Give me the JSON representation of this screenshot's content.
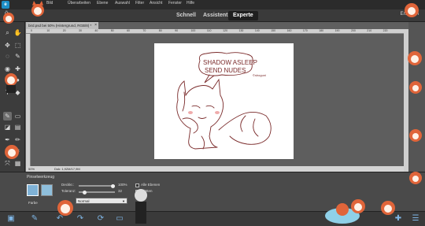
{
  "menubar": {
    "items": [
      "Bild",
      "Überarbeiten",
      "Ebene",
      "Auswahl",
      "Filter",
      "Ansicht",
      "Fenster",
      "Hilfe"
    ]
  },
  "modebar": {
    "open_label": "Ö",
    "modes": [
      "Schnell",
      "Assistent",
      "Experte"
    ],
    "active_mode": "Experte",
    "create_label": "Erstellen"
  },
  "document": {
    "tab_title": "bird.psd bei 50% (Hintergrund, RGB/8) *",
    "close_glyph": "×",
    "ruler_ticks": [
      "0",
      "10",
      "20",
      "30",
      "40",
      "50",
      "60",
      "70",
      "80",
      "90",
      "100",
      "110",
      "120",
      "130",
      "140",
      "150",
      "160",
      "170",
      "180",
      "190",
      "200",
      "210",
      "220"
    ]
  },
  "canvas": {
    "speech_line1": "SHADOW ASLEEP",
    "speech_line2": "SEND NUDES",
    "signature": "©shoguni"
  },
  "status": {
    "zoom": "50%",
    "doc_info": "Dok: 1,92M/17,9M"
  },
  "options": {
    "tool_name": "Pinselwerkzeug",
    "opacity_label": "Deckkr.:",
    "opacity_value": "100%",
    "opacity_level": 1.0,
    "tolerance_label": "Toleranz:",
    "tolerance_value": "32",
    "tolerance_level": 0.12,
    "blend_mode": "Normal",
    "all_layers_label": "Alle Ebenen",
    "aa_label": "Glätten",
    "fill_label": "Farbe"
  },
  "colors": {
    "accent": "#1e90c8",
    "sketch": "#7a2a2a",
    "fox_orange": "#e0653a"
  }
}
